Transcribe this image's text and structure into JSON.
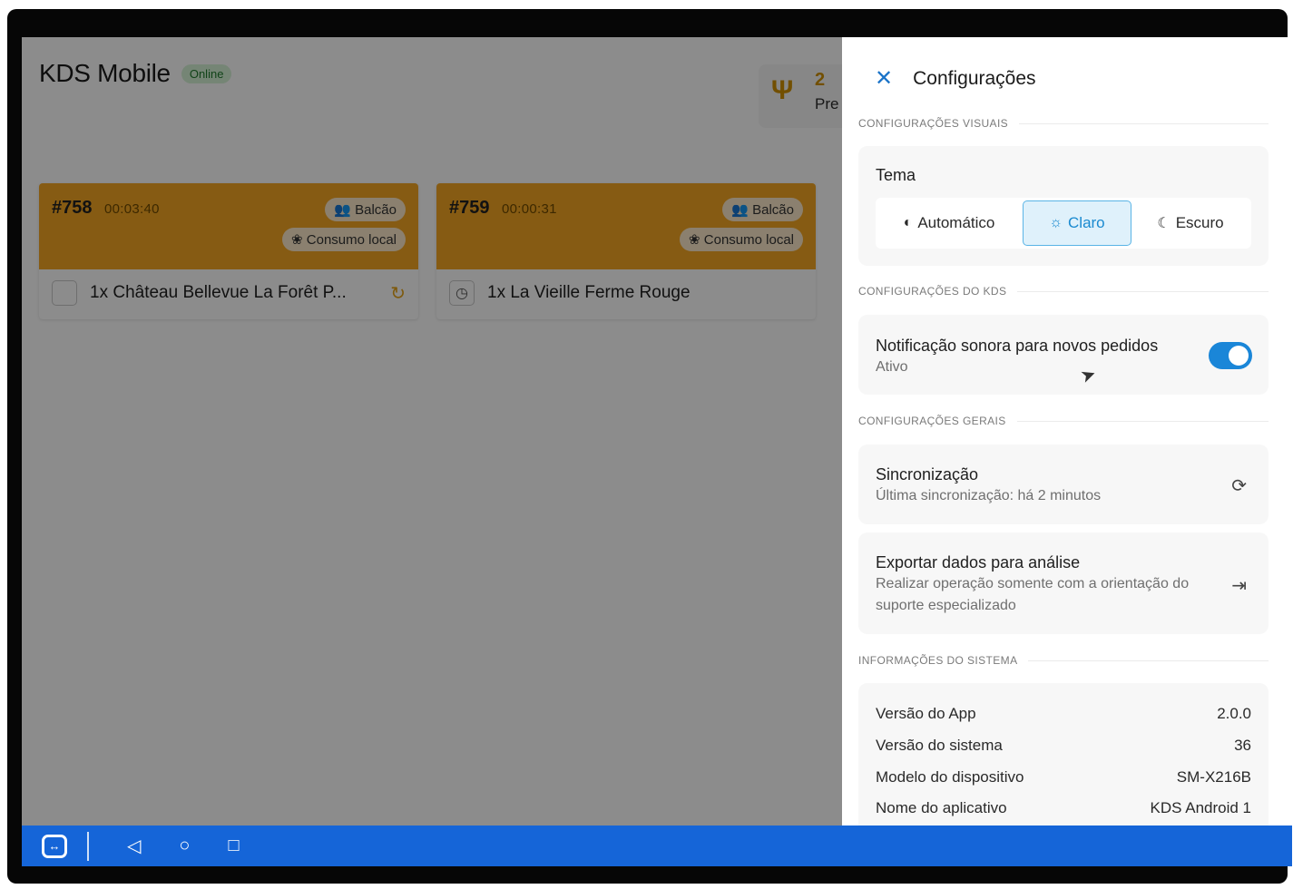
{
  "app": {
    "title": "KDS Mobile",
    "status_badge": "Online",
    "summary": {
      "count": "2",
      "label": "Pre"
    }
  },
  "orders": [
    {
      "number": "#758",
      "timer": "00:03:40",
      "tag_1": "👥 Balcão",
      "tag_2": "❀ Consumo local",
      "item": "1x Château Bellevue La Forêt P..."
    },
    {
      "number": "#759",
      "timer": "00:00:31",
      "tag_1": "👥 Balcão",
      "tag_2": "❀ Consumo local",
      "item": "1x La Vieille Ferme Rouge"
    }
  ],
  "drawer": {
    "title": "Configurações",
    "sections": {
      "visual": "CONFIGURAÇÕES VISUAIS",
      "kds": "CONFIGURAÇÕES DO KDS",
      "general": "CONFIGURAÇÕES GERAIS",
      "system": "INFORMAÇÕES DO SISTEMA"
    },
    "theme": {
      "label": "Tema",
      "options": [
        "Automático",
        "Claro",
        "Escuro"
      ],
      "selected": "Claro"
    },
    "sound_notification": {
      "title": "Notificação sonora para novos pedidos",
      "status": "Ativo",
      "enabled": true
    },
    "sync": {
      "title": "Sincronização",
      "subtitle": "Última sincronização: há 2 minutos"
    },
    "export": {
      "title": "Exportar dados para análise",
      "subtitle": "Realizar operação somente com a orientação do suporte especializado"
    },
    "system_info": [
      {
        "label": "Versão do App",
        "value": "2.0.0"
      },
      {
        "label": "Versão do sistema",
        "value": "36"
      },
      {
        "label": "Modelo do dispositivo",
        "value": "SM-X216B"
      },
      {
        "label": "Nome do aplicativo",
        "value": "KDS Android 1"
      }
    ]
  },
  "colors": {
    "order_header": "#f5a623",
    "accent": "#1a86d8",
    "navbar": "#1565d8"
  },
  "icons": {
    "close": "close-icon",
    "sync": "sync-icon",
    "export": "export-icon",
    "cutlery": "cutlery-icon"
  }
}
